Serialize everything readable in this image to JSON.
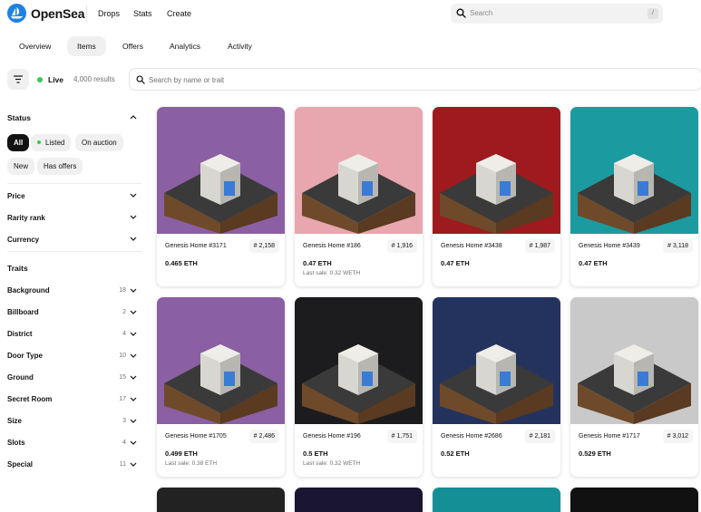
{
  "header": {
    "brand": "OpenSea",
    "nav": [
      "Drops",
      "Stats",
      "Create"
    ],
    "search_placeholder": "Search",
    "search_shortcut": "/"
  },
  "tabs": [
    "Overview",
    "Items",
    "Offers",
    "Analytics",
    "Activity"
  ],
  "active_tab": "Items",
  "filter_bar": {
    "live_label": "Live",
    "results": "4,000 results",
    "search_placeholder": "Search by name or trait"
  },
  "sidebar": {
    "status_heading": "Status",
    "status_chips": [
      "All",
      "Listed",
      "On auction",
      "New",
      "Has offers"
    ],
    "filters": [
      "Price",
      "Rarity rank",
      "Currency"
    ],
    "traits_heading": "Traits",
    "traits": [
      {
        "name": "Background",
        "count": "18"
      },
      {
        "name": "Billboard",
        "count": "2"
      },
      {
        "name": "District",
        "count": "4"
      },
      {
        "name": "Door Type",
        "count": "10"
      },
      {
        "name": "Ground",
        "count": "15"
      },
      {
        "name": "Secret Room",
        "count": "17"
      },
      {
        "name": "Size",
        "count": "3"
      },
      {
        "name": "Slots",
        "count": "4"
      },
      {
        "name": "Special",
        "count": "11"
      }
    ]
  },
  "items": [
    {
      "name": "Genesis Home #3171",
      "rank": "# 2,158",
      "price": "0.465 ETH",
      "last_sale": "",
      "bg": "#8b5fa3"
    },
    {
      "name": "Genesis Home #186",
      "rank": "# 1,916",
      "price": "0.47 ETH",
      "last_sale": "Last sale: 0.32 WETH",
      "bg": "#e8a6ae"
    },
    {
      "name": "Genesis Home #3438",
      "rank": "# 1,987",
      "price": "0.47 ETH",
      "last_sale": "",
      "bg": "#9e1a1e"
    },
    {
      "name": "Genesis Home #3439",
      "rank": "# 3,118",
      "price": "0.47 ETH",
      "last_sale": "",
      "bg": "#1b9aa0"
    },
    {
      "name": "Genesis Home #1705",
      "rank": "# 2,486",
      "price": "0.499 ETH",
      "last_sale": "Last sale: 0.38 ETH",
      "bg": "#8b5fa3"
    },
    {
      "name": "Genesis Home #196",
      "rank": "# 1,751",
      "price": "0.5 ETH",
      "last_sale": "Last sale: 0.32 WETH",
      "bg": "#1c1c1e"
    },
    {
      "name": "Genesis Home #2686",
      "rank": "# 2,181",
      "price": "0.52 ETH",
      "last_sale": "",
      "bg": "#24335e"
    },
    {
      "name": "Genesis Home #1717",
      "rank": "# 3,012",
      "price": "0.529 ETH",
      "last_sale": "",
      "bg": "#c9c9c9"
    }
  ],
  "partial_backgrounds": [
    "#222222",
    "#1a1530",
    "#158f96",
    "#111111"
  ]
}
